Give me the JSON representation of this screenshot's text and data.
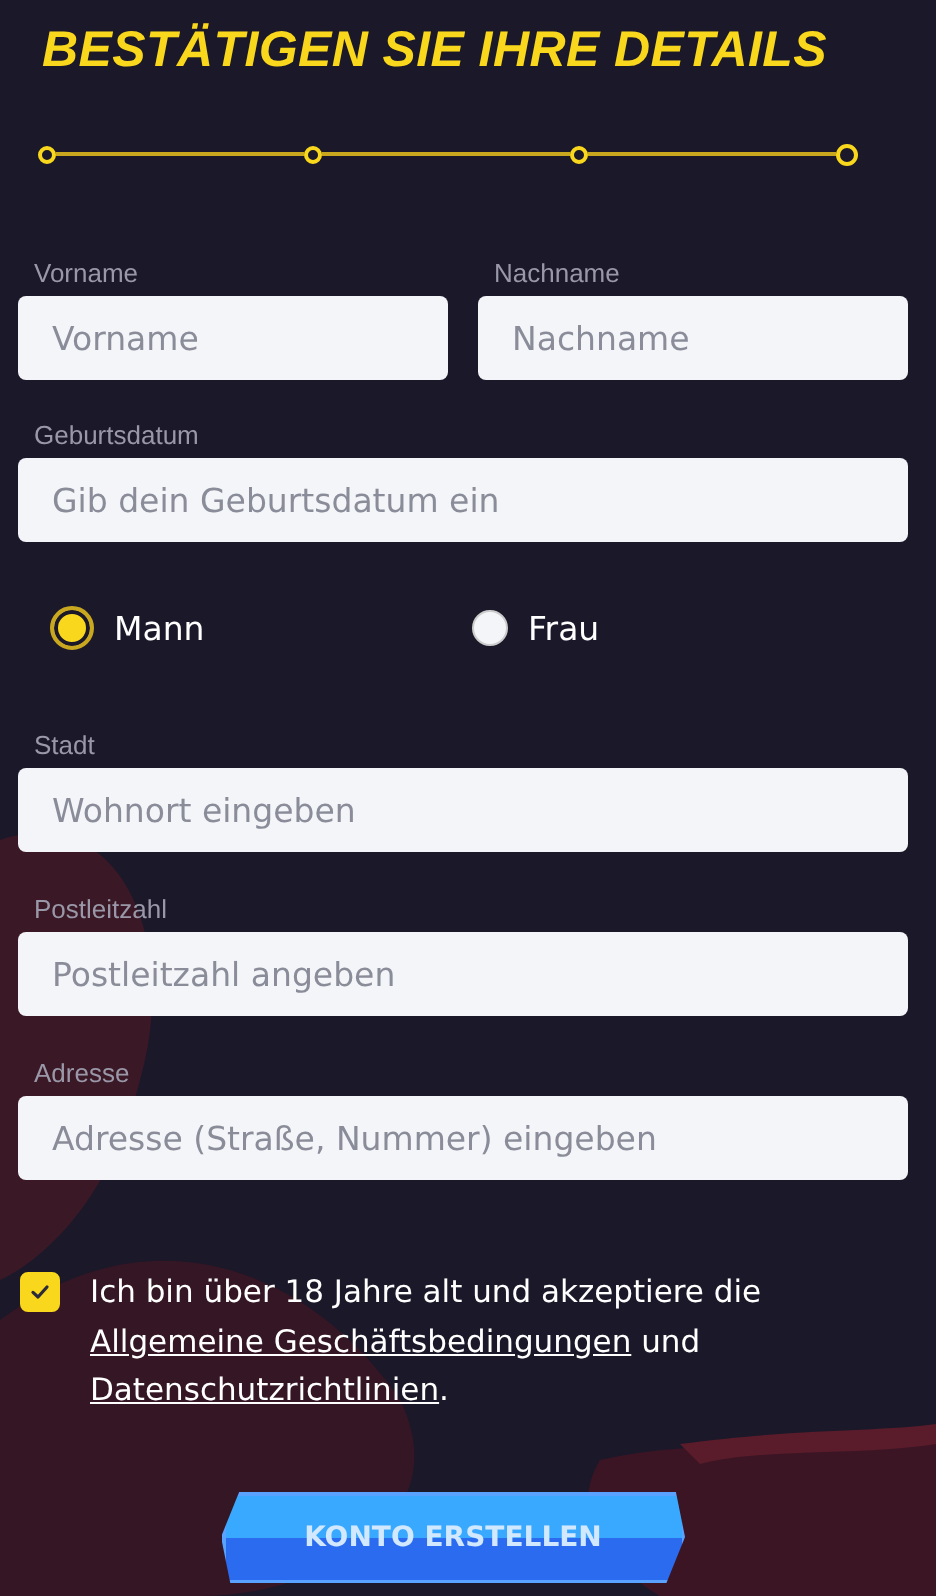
{
  "title": "BESTÄTIGEN SIE IHRE DETAILS",
  "steps": [
    {
      "current": false
    },
    {
      "current": false
    },
    {
      "current": false
    },
    {
      "current": true
    }
  ],
  "name_fields": [
    {
      "label": "Vorname",
      "placeholder": "Vorname"
    },
    {
      "label": "Nachname",
      "placeholder": "Nachname"
    }
  ],
  "birthdate": {
    "label": "Geburtsdatum",
    "placeholder": "Gib dein Geburtsdatum ein"
  },
  "gender": [
    {
      "label": "Mann",
      "selected": true
    },
    {
      "label": "Frau",
      "selected": false
    }
  ],
  "address_fields": [
    {
      "label": "Stadt",
      "placeholder": "Wohnort eingeben"
    },
    {
      "label": "Postleitzahl",
      "placeholder": "Postleitzahl angeben"
    },
    {
      "label": "Adresse",
      "placeholder": "Adresse (Straße, Nummer) eingeben"
    }
  ],
  "consent": {
    "checked": true,
    "text": "Ich bin über 18 Jahre alt und akzeptiere die",
    "link_1": "Allgemeine Geschäftsbedingungen",
    "joiner": "und",
    "link_2": "Datenschutzrichtlinien",
    "end": "."
  },
  "submit": {
    "label": "KONTO ERSTELLEN",
    "disabled": true
  }
}
